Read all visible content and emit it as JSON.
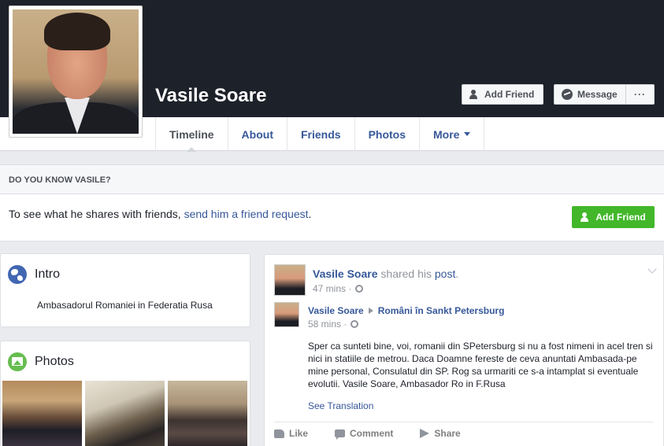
{
  "profile": {
    "name": "Vasile Soare"
  },
  "cover_buttons": {
    "add_friend": "Add Friend",
    "message": "Message",
    "more": "···"
  },
  "tabs": [
    {
      "label": "Timeline",
      "active": true
    },
    {
      "label": "About",
      "active": false
    },
    {
      "label": "Friends",
      "active": false
    },
    {
      "label": "Photos",
      "active": false
    },
    {
      "label": "More",
      "active": false
    }
  ],
  "know_box": {
    "heading": "DO YOU KNOW VASILE?",
    "text_prefix": "To see what he shares with friends, ",
    "link": "send him a friend request",
    "text_suffix": ".",
    "button": "Add Friend"
  },
  "intro": {
    "title": "Intro",
    "bio": "Ambasadorul Romaniei in Federatia Rusa"
  },
  "photos_card": {
    "title": "Photos"
  },
  "post": {
    "author": "Vasile Soare",
    "action_text": " shared his ",
    "object": "post",
    "period": ".",
    "time": "47 mins ·",
    "shared": {
      "author": "Vasile Soare",
      "group": "Români în Sankt Petersburg",
      "time": "58 mins ·",
      "body": "Sper ca sunteti bine, voi, romanii din SPetersburg si nu a fost nimeni in acel tren si nici in statiile de metrou. Daca Doamne fereste de ceva anuntati Ambasada-pe mine personal, Consulatul din SP. Rog sa urmariti ce s-a intamplat si eventuale evolutii. Vasile Soare, Ambasador Ro in F.Rusa",
      "see_translation": "See Translation"
    },
    "actions": {
      "like": "Like",
      "comment": "Comment",
      "share": "Share"
    }
  },
  "colors": {
    "cover_bg": "#1d2129",
    "link_blue": "#365899",
    "green_button": "#42b72a",
    "page_bg": "#e9ebee"
  }
}
